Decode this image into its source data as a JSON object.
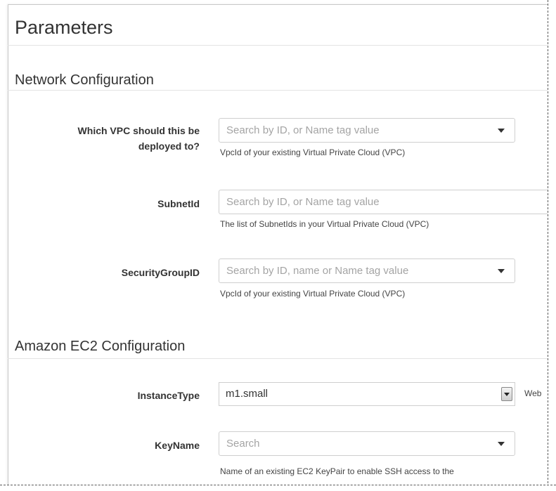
{
  "title": "Parameters",
  "sections": [
    {
      "heading": "Network Configuration",
      "fields": [
        {
          "label_line1": "Which VPC should this be",
          "label_line2": "deployed to?",
          "placeholder": "Search by ID, or Name tag value",
          "help": "VpcId of your existing Virtual Private Cloud (VPC)"
        },
        {
          "label": "SubnetId",
          "placeholder": "Search by ID, or Name tag value",
          "help": "The list of SubnetIds in your Virtual Private Cloud (VPC)"
        },
        {
          "label": "SecurityGroupID",
          "placeholder": "Search by ID, name or Name tag value",
          "help": "VpcId of your existing Virtual Private Cloud (VPC)"
        }
      ]
    },
    {
      "heading": "Amazon EC2 Configuration",
      "fields": [
        {
          "label": "InstanceType",
          "value": "m1.small",
          "side_text": "Web"
        },
        {
          "label": "KeyName",
          "placeholder": "Search",
          "help": "Name of an existing EC2 KeyPair to enable SSH access to the"
        }
      ]
    }
  ],
  "icons": {
    "dropdown": "caret-down-icon"
  }
}
